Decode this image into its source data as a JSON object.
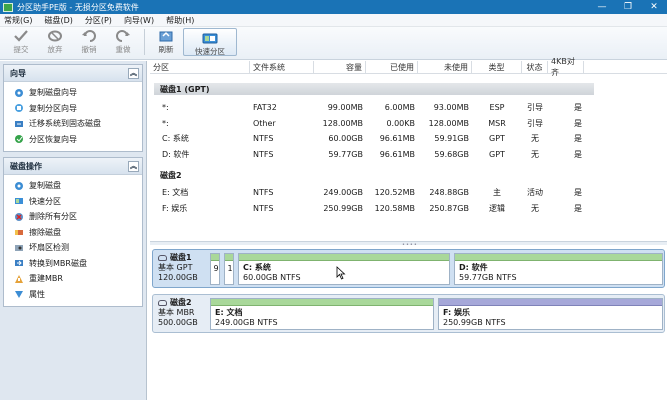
{
  "window": {
    "title": "分区助手PE版 - 无损分区免费软件",
    "controls": {
      "minimize": "—",
      "restore": "❐",
      "close": "✕"
    }
  },
  "menu": [
    {
      "label": "常规(G)"
    },
    {
      "label": "磁盘(D)"
    },
    {
      "label": "分区(P)"
    },
    {
      "label": "向导(W)"
    },
    {
      "label": "帮助(H)"
    }
  ],
  "toolbar": {
    "commit": "提交",
    "discard": "放弃",
    "undo": "撤销",
    "redo": "重做",
    "refresh": "刷新",
    "quick_partition": "快速分区"
  },
  "sidebar": {
    "wizard": {
      "title": "向导",
      "items": [
        {
          "label": "复制磁盘向导",
          "icon": "copy-disk-icon"
        },
        {
          "label": "复制分区向导",
          "icon": "copy-partition-icon"
        },
        {
          "label": "迁移系统到固态磁盘",
          "icon": "migrate-ssd-icon"
        },
        {
          "label": "分区恢复向导",
          "icon": "recover-partition-icon"
        }
      ]
    },
    "disk_ops": {
      "title": "磁盘操作",
      "items": [
        {
          "label": "复制磁盘",
          "icon": "copy-icon"
        },
        {
          "label": "快速分区",
          "icon": "quick-partition-icon"
        },
        {
          "label": "删除所有分区",
          "icon": "delete-icon"
        },
        {
          "label": "擦除磁盘",
          "icon": "wipe-icon"
        },
        {
          "label": "坏扇区检测",
          "icon": "bad-sector-icon"
        },
        {
          "label": "转换到MBR磁盘",
          "icon": "convert-icon"
        },
        {
          "label": "重建MBR",
          "icon": "rebuild-mbr-icon"
        },
        {
          "label": "属性",
          "icon": "properties-icon"
        }
      ]
    }
  },
  "table": {
    "headers": {
      "partition": "分区",
      "fs": "文件系统",
      "capacity": "容量",
      "used": "已使用",
      "free": "未使用",
      "type": "类型",
      "state": "状态",
      "align4k": "4KB对齐"
    },
    "disk1_label": "磁盘1 (GPT)",
    "disk1_rows": [
      {
        "part": "*:",
        "fs": "FAT32",
        "cap": "99.00MB",
        "used": "6.00MB",
        "free": "93.00MB",
        "type": "ESP",
        "state": "引导",
        "align": "是"
      },
      {
        "part": "*:",
        "fs": "Other",
        "cap": "128.00MB",
        "used": "0.00KB",
        "free": "128.00MB",
        "type": "MSR",
        "state": "引导",
        "align": "是"
      },
      {
        "part": "C: 系统",
        "fs": "NTFS",
        "cap": "60.00GB",
        "used": "96.61MB",
        "free": "59.91GB",
        "type": "GPT",
        "state": "无",
        "align": "是"
      },
      {
        "part": "D: 软件",
        "fs": "NTFS",
        "cap": "59.77GB",
        "used": "96.61MB",
        "free": "59.68GB",
        "type": "GPT",
        "state": "无",
        "align": "是"
      }
    ],
    "disk2_label": "磁盘2",
    "disk2_rows": [
      {
        "part": "E: 文档",
        "fs": "NTFS",
        "cap": "249.00GB",
        "used": "120.52MB",
        "free": "248.88GB",
        "type": "主",
        "state": "活动",
        "align": "是"
      },
      {
        "part": "F: 娱乐",
        "fs": "NTFS",
        "cap": "250.99GB",
        "used": "120.58MB",
        "free": "250.87GB",
        "type": "逻辑",
        "state": "无",
        "align": "是"
      }
    ]
  },
  "diskmap": {
    "disk1": {
      "name": "磁盘1",
      "kind": "基本 GPT",
      "size": "120.00GB",
      "tiny1": "9",
      "tiny2": "1",
      "c_name": "C: 系统",
      "c_info": "60.00GB NTFS",
      "d_name": "D: 软件",
      "d_info": "59.77GB NTFS"
    },
    "disk2": {
      "name": "磁盘2",
      "kind": "基本 MBR",
      "size": "500.00GB",
      "e_name": "E: 文档",
      "e_info": "249.00GB NTFS",
      "f_name": "F: 娱乐",
      "f_info": "250.99GB NTFS"
    }
  },
  "colors": {
    "titlebar": "#1a73b6",
    "partition_primary": "#a9d89a",
    "partition_logical": "#a6a8d9",
    "disk_selected": "#cfe0f2"
  }
}
